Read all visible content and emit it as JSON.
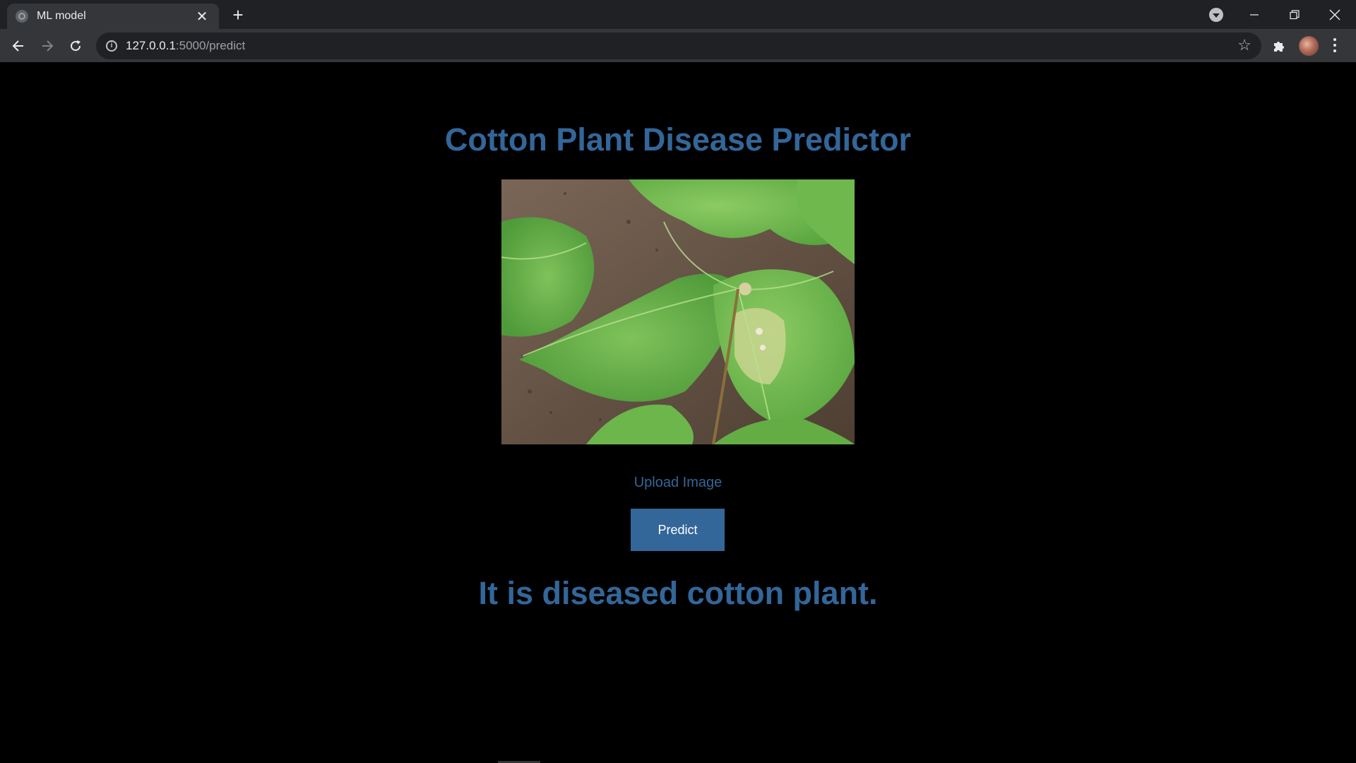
{
  "browser": {
    "tab_title": "ML model",
    "url_host": "127.0.0.1",
    "url_path": ":5000/predict",
    "icons": [
      "globe-icon",
      "close-icon",
      "plus-icon",
      "back-icon",
      "forward-icon",
      "reload-icon",
      "info-icon",
      "star-icon",
      "puzzle-icon",
      "kebab-menu-icon",
      "minimize-icon",
      "restore-icon"
    ]
  },
  "page": {
    "heading": "Cotton Plant Disease Predictor",
    "upload_label": "Upload Image",
    "predict_label": "Predict",
    "result_text": "It is diseased cotton plant."
  },
  "colors": {
    "accent": "#336699",
    "background": "#000000",
    "chrome_dark": "#202124",
    "chrome_toolbar": "#35363a"
  }
}
